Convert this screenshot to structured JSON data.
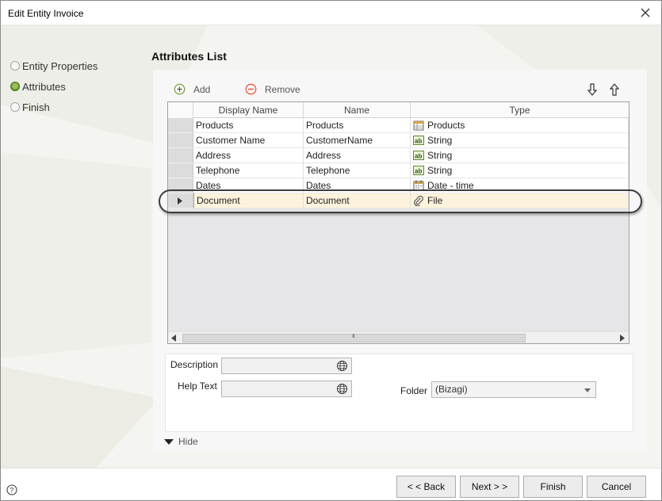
{
  "window": {
    "title": "Edit Entity Invoice"
  },
  "wizard": {
    "steps": [
      {
        "label": "Entity Properties",
        "active": false
      },
      {
        "label": "Attributes",
        "active": true
      },
      {
        "label": "Finish",
        "active": false
      }
    ]
  },
  "section": {
    "title": "Attributes List"
  },
  "toolbar": {
    "add_label": "Add",
    "remove_label": "Remove"
  },
  "grid": {
    "columns": [
      "Display Name",
      "Name",
      "Type"
    ],
    "rows": [
      {
        "display_name": "Products",
        "name": "Products",
        "type": "Products",
        "type_icon": "entity-table-icon"
      },
      {
        "display_name": "Customer Name",
        "name": "CustomerName",
        "type": "String",
        "type_icon": "string-ab-icon"
      },
      {
        "display_name": "Address",
        "name": "Address",
        "type": "String",
        "type_icon": "string-ab-icon"
      },
      {
        "display_name": "Telephone",
        "name": "Telephone",
        "type": "String",
        "type_icon": "string-ab-icon"
      },
      {
        "display_name": "Dates",
        "name": "Dates",
        "type": "Date - time",
        "type_icon": "calendar-icon"
      },
      {
        "display_name": "Document",
        "name": "Document",
        "type": "File",
        "type_icon": "paperclip-icon",
        "selected": true
      }
    ],
    "scroll_grip": "III"
  },
  "details": {
    "description_label": "Description",
    "description_value": "",
    "help_text_label": "Help Text",
    "help_text_value": "",
    "folder_label": "Folder",
    "folder_value": "(Bizagi)"
  },
  "hide_label": "Hide",
  "buttons": {
    "back": "< < Back",
    "next": "Next > >",
    "finish": "Finish",
    "cancel": "Cancel"
  },
  "colors": {
    "active_step": "#6a9a2c",
    "selected_row": "#fdf3dc",
    "remove_icon": "#e0563b",
    "add_icon": "#6a9a2c"
  }
}
